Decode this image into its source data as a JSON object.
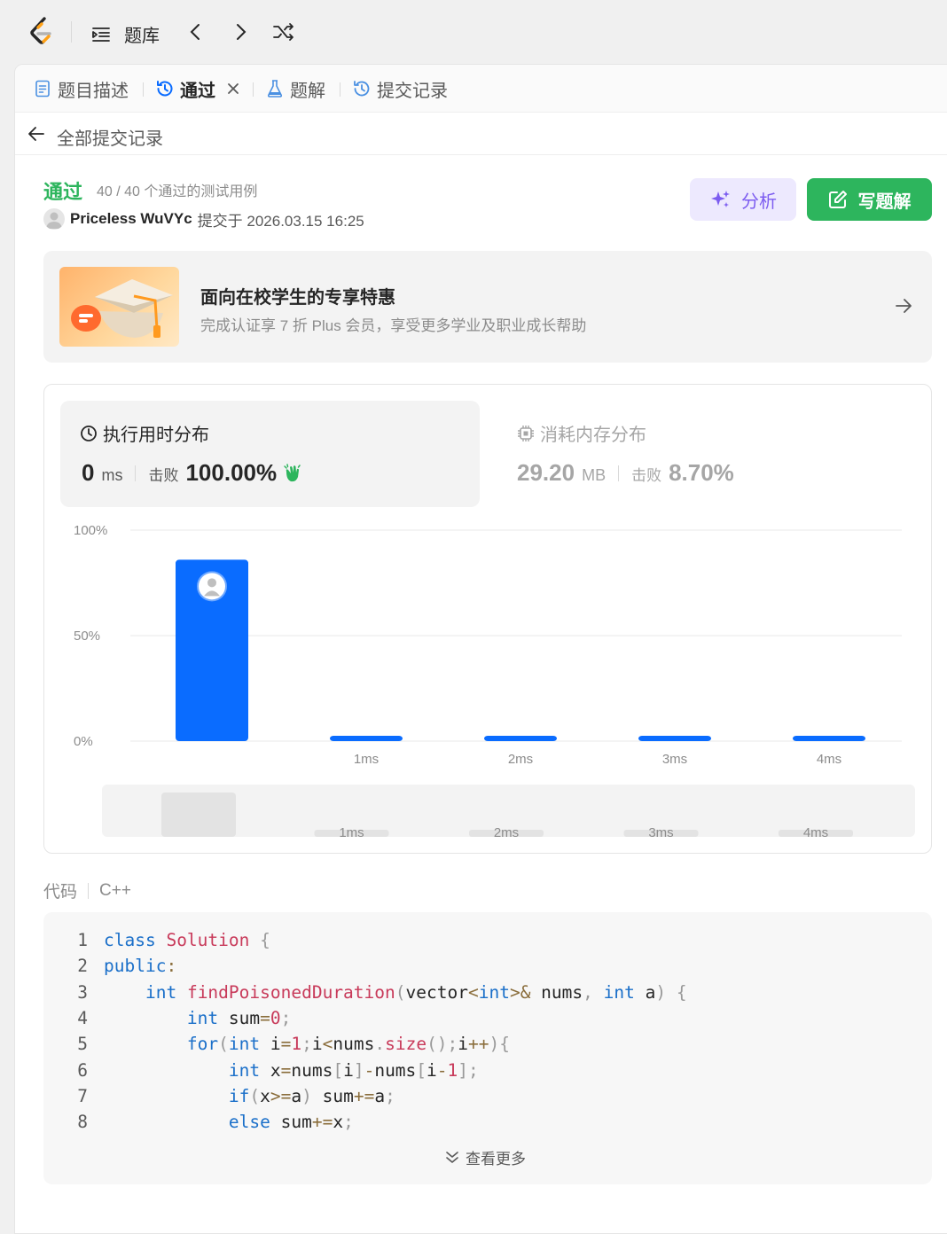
{
  "topbar": {
    "problem_bank_label": "题库"
  },
  "colors": {
    "accept_green": "#2db55d",
    "bar_blue": "#0a6cff",
    "analyze_purple": "#7c5cf0"
  },
  "tabs": [
    {
      "label": "题目描述",
      "icon": "description-icon"
    },
    {
      "label": "通过",
      "icon": "history-icon",
      "active": true
    },
    {
      "label": "题解",
      "icon": "flask-icon"
    },
    {
      "label": "提交记录",
      "icon": "history-icon"
    }
  ],
  "back": {
    "label": "全部提交记录"
  },
  "result": {
    "status": "通过",
    "testcases": "40 / 40 个通过的测试用例",
    "user": "Priceless WuVYc",
    "submitted_at": "提交于 2026.03.15 16:25"
  },
  "buttons": {
    "analyze": "分析",
    "write_solution": "写题解"
  },
  "promo": {
    "title": "面向在校学生的专享特惠",
    "subtitle": "完成认证享 7 折 Plus 会员，享受更多学业及职业成长帮助"
  },
  "runtime": {
    "title": "执行用时分布",
    "value": "0",
    "unit": "ms",
    "beat_label": "击败",
    "beat_value": "100.00%"
  },
  "memory": {
    "title": "消耗内存分布",
    "value": "29.20",
    "unit": "MB",
    "beat_label": "击败",
    "beat_value": "8.70%"
  },
  "chart_data": {
    "type": "bar",
    "categories": [
      "0ms",
      "1ms",
      "2ms",
      "3ms",
      "4ms"
    ],
    "tick_labels": [
      "",
      "1ms",
      "2ms",
      "3ms",
      "4ms"
    ],
    "values": [
      86,
      1.5,
      1.5,
      2.5,
      1.5
    ],
    "yticks": [
      "100%",
      "50%",
      "0%"
    ],
    "ylim": [
      0,
      100
    ],
    "highlight_index": 0
  },
  "code": {
    "label": "代码",
    "language": "C++",
    "more_label": "查看更多",
    "lines": [
      {
        "n": "1",
        "tokens": [
          [
            "kw",
            "class"
          ],
          [
            "id",
            " "
          ],
          [
            "cls",
            "Solution"
          ],
          [
            "id",
            " "
          ],
          [
            "pn",
            "{"
          ]
        ]
      },
      {
        "n": "2",
        "tokens": [
          [
            "kw",
            "public"
          ],
          [
            "op",
            ":"
          ]
        ]
      },
      {
        "n": "3",
        "tokens": [
          [
            "id",
            "    "
          ],
          [
            "kw",
            "int"
          ],
          [
            "id",
            " "
          ],
          [
            "fn",
            "findPoisonedDuration"
          ],
          [
            "pn",
            "("
          ],
          [
            "id",
            "vector"
          ],
          [
            "op",
            "<"
          ],
          [
            "kw",
            "int"
          ],
          [
            "op",
            ">&"
          ],
          [
            "id",
            " nums"
          ],
          [
            "pn",
            ","
          ],
          [
            "id",
            " "
          ],
          [
            "kw",
            "int"
          ],
          [
            "id",
            " a"
          ],
          [
            "pn",
            ")"
          ],
          [
            "id",
            " "
          ],
          [
            "pn",
            "{"
          ]
        ]
      },
      {
        "n": "4",
        "tokens": [
          [
            "id",
            "        "
          ],
          [
            "kw",
            "int"
          ],
          [
            "id",
            " sum"
          ],
          [
            "op",
            "="
          ],
          [
            "num",
            "0"
          ],
          [
            "pn",
            ";"
          ]
        ]
      },
      {
        "n": "5",
        "tokens": [
          [
            "id",
            "        "
          ],
          [
            "kw",
            "for"
          ],
          [
            "pn",
            "("
          ],
          [
            "kw",
            "int"
          ],
          [
            "id",
            " i"
          ],
          [
            "op",
            "="
          ],
          [
            "num",
            "1"
          ],
          [
            "pn",
            ";"
          ],
          [
            "id",
            "i"
          ],
          [
            "op",
            "<"
          ],
          [
            "id",
            "nums"
          ],
          [
            "pn",
            "."
          ],
          [
            "fn",
            "size"
          ],
          [
            "pn",
            "();"
          ],
          [
            "id",
            "i"
          ],
          [
            "op",
            "++"
          ],
          [
            "pn",
            "){"
          ]
        ]
      },
      {
        "n": "6",
        "tokens": [
          [
            "id",
            "            "
          ],
          [
            "kw",
            "int"
          ],
          [
            "id",
            " x"
          ],
          [
            "op",
            "="
          ],
          [
            "id",
            "nums"
          ],
          [
            "pn",
            "["
          ],
          [
            "id",
            "i"
          ],
          [
            "pn",
            "]"
          ],
          [
            "op",
            "-"
          ],
          [
            "id",
            "nums"
          ],
          [
            "pn",
            "["
          ],
          [
            "id",
            "i"
          ],
          [
            "op",
            "-"
          ],
          [
            "num",
            "1"
          ],
          [
            "pn",
            "];"
          ]
        ]
      },
      {
        "n": "7",
        "tokens": [
          [
            "id",
            "            "
          ],
          [
            "kw",
            "if"
          ],
          [
            "pn",
            "("
          ],
          [
            "id",
            "x"
          ],
          [
            "op",
            ">="
          ],
          [
            "id",
            "a"
          ],
          [
            "pn",
            ")"
          ],
          [
            "id",
            " sum"
          ],
          [
            "op",
            "+="
          ],
          [
            "id",
            "a"
          ],
          [
            "pn",
            ";"
          ]
        ]
      },
      {
        "n": "8",
        "tokens": [
          [
            "id",
            "            "
          ],
          [
            "kw",
            "else"
          ],
          [
            "id",
            " sum"
          ],
          [
            "op",
            "+="
          ],
          [
            "id",
            "x"
          ],
          [
            "pn",
            ";"
          ]
        ]
      }
    ]
  }
}
